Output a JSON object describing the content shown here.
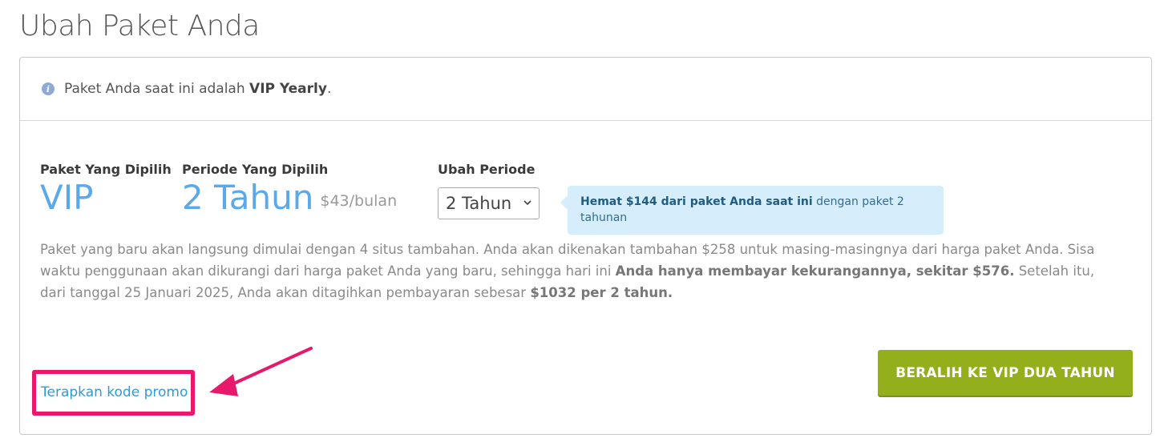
{
  "page": {
    "title": "Ubah Paket Anda"
  },
  "header": {
    "info_prefix": "Paket Anda saat ini adalah ",
    "current_plan": "VIP Yearly",
    "info_suffix": ".",
    "icon": "info-icon"
  },
  "selection": {
    "plan_label": "Paket Yang Dipilih",
    "plan_value": "VIP",
    "period_label": "Periode Yang Dipilih",
    "period_value": "2 Tahun",
    "price_per_month": "$43/bulan",
    "change_period_label": "Ubah Periode",
    "change_period_selected": "2 Tahun"
  },
  "callout": {
    "bold_text": "Hemat $144 dari paket Anda saat ini",
    "rest_text": " dengan paket 2 tahunan"
  },
  "description": {
    "part1": "Paket yang baru akan langsung dimulai dengan 4 situs tambahan. Anda akan dikenakan tambahan $258 untuk masing-masingnya dari harga paket Anda. Sisa waktu penggunaan akan dikurangi dari harga paket Anda yang baru, sehingga hari ini ",
    "bold1": "Anda hanya membayar kekurangannya, sekitar $576.",
    "part2": " Setelah itu, dari tanggal 25 Januari 2025, Anda akan ditagihkan pembayaran sebesar ",
    "bold2": "$1032 per 2 tahun."
  },
  "actions": {
    "promo_link": "Terapkan kode promo",
    "switch_button": "BERALIH KE VIP DUA TAHUN"
  },
  "colors": {
    "accent_blue": "#5ba8ea",
    "button_green": "#93b01c",
    "highlight_pink": "#e8196b",
    "callout_bg": "#d6eefb"
  }
}
